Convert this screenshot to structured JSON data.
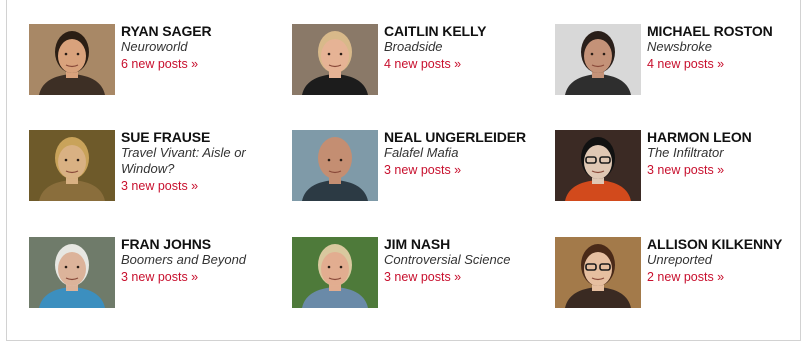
{
  "authors": [
    {
      "name": "RYAN SAGER",
      "blog": "Neuroworld",
      "posts": "6 new posts »",
      "photo": {
        "bg": "#a88866",
        "skin": "#d9a27c",
        "hair": "#2b1e14",
        "shirt": "#3d2f25",
        "glasses": false
      }
    },
    {
      "name": "CAITLIN KELLY",
      "blog": "Broadside",
      "posts": "4 new posts »",
      "photo": {
        "bg": "#8a7968",
        "skin": "#e6b395",
        "hair": "#d8b98a",
        "shirt": "#1c1c1c",
        "glasses": false
      }
    },
    {
      "name": "MICHAEL ROSTON",
      "blog": "Newsbroke",
      "posts": "4 new posts »",
      "photo": {
        "bg": "#d8d8d8",
        "skin": "#c49278",
        "hair": "#2a1f1a",
        "shirt": "#2e2e2e",
        "glasses": false
      }
    },
    {
      "name": "SUE FRAUSE",
      "blog": "Travel Vivant: Aisle or Window?",
      "posts": "3 new posts »",
      "photo": {
        "bg": "#6e5a2a",
        "skin": "#d9b183",
        "hair": "#c9a35a",
        "shirt": "#8a6e3c",
        "glasses": false
      }
    },
    {
      "name": "NEAL UNGERLEIDER",
      "blog": "Falafel Mafia",
      "posts": "3 new posts »",
      "photo": {
        "bg": "#7f9aa8",
        "skin": "#c48e72",
        "hair": "#c48e72",
        "shirt": "#2c3a44",
        "glasses": false
      }
    },
    {
      "name": "HARMON LEON",
      "blog": "The Infiltrator",
      "posts": "3 new posts »",
      "photo": {
        "bg": "#3b2a24",
        "skin": "#e0c8b4",
        "hair": "#111111",
        "shirt": "#d24a1c",
        "glasses": true
      }
    },
    {
      "name": "FRAN JOHNS",
      "blog": "Boomers and Beyond",
      "posts": "3 new posts »",
      "photo": {
        "bg": "#6f7b6a",
        "skin": "#dcb39a",
        "hair": "#e7e7e2",
        "shirt": "#3c8fbf",
        "glasses": false
      }
    },
    {
      "name": "JIM NASH",
      "blog": "Controversial Science",
      "posts": "3 new posts »",
      "photo": {
        "bg": "#4e7a3a",
        "skin": "#e2ad90",
        "hair": "#d9c89e",
        "shirt": "#6a8aa8",
        "glasses": false
      }
    },
    {
      "name": "ALLISON KILKENNY",
      "blog": "Unreported",
      "posts": "2 new posts »",
      "photo": {
        "bg": "#a37a4a",
        "skin": "#e6bfa0",
        "hair": "#4a2a18",
        "shirt": "#3a2a22",
        "glasses": true
      }
    }
  ]
}
